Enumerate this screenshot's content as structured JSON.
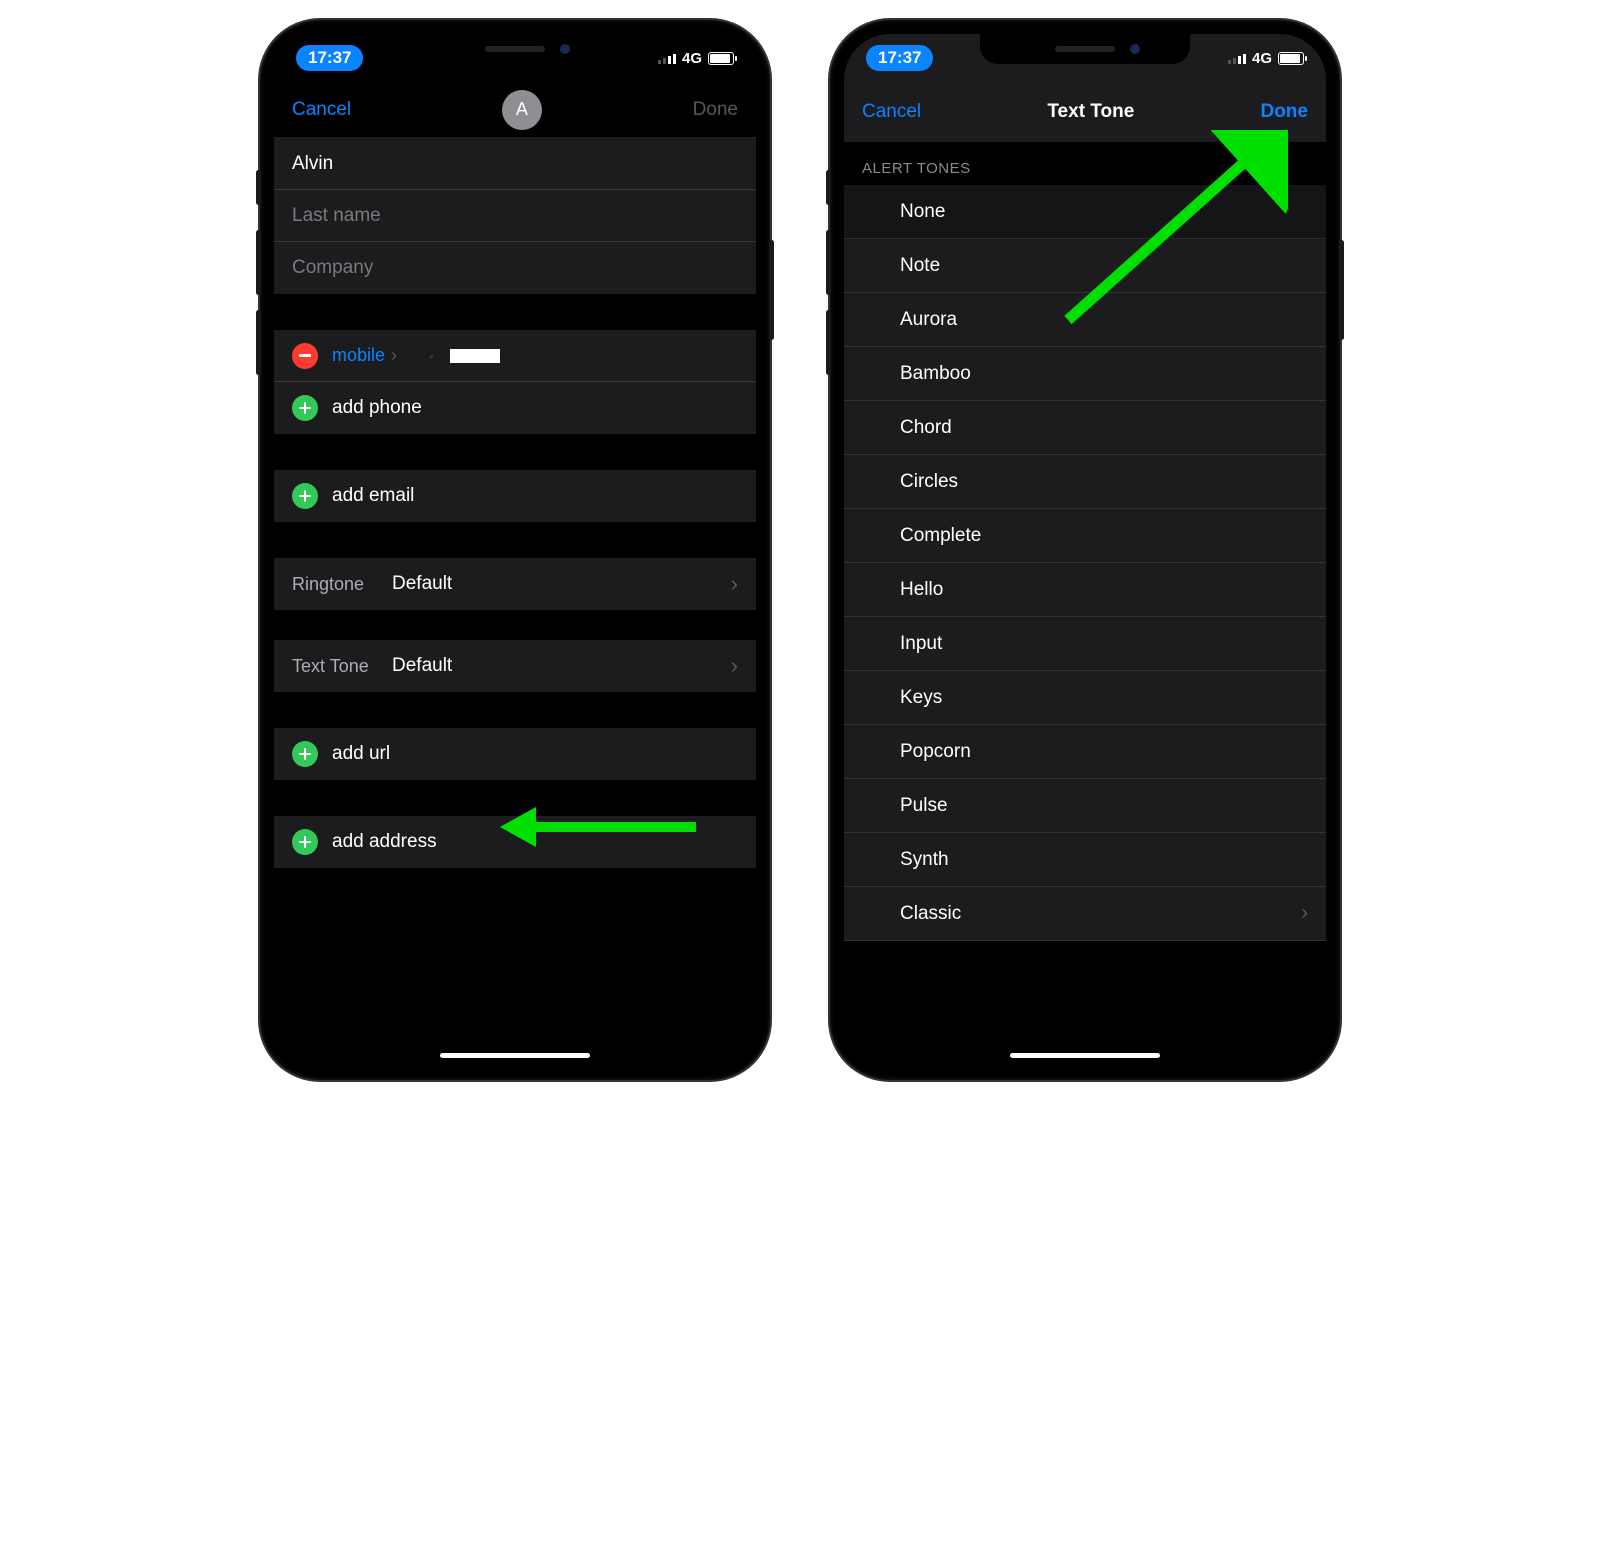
{
  "statusbar": {
    "time": "17:37",
    "network": "4G"
  },
  "left": {
    "nav": {
      "cancel": "Cancel",
      "done": "Done",
      "avatar_initial": "A"
    },
    "fields": {
      "first_name": "Alvin",
      "last_name_placeholder": "Last name",
      "company_placeholder": "Company"
    },
    "phone": {
      "type": "mobile",
      "add_phone": "add phone"
    },
    "email": {
      "add_email": "add email"
    },
    "ringtone": {
      "label": "Ringtone",
      "value": "Default"
    },
    "texttone": {
      "label": "Text Tone",
      "value": "Default"
    },
    "url": {
      "add_url": "add url"
    },
    "address": {
      "add_address": "add address"
    }
  },
  "right": {
    "nav": {
      "cancel": "Cancel",
      "title": "Text Tone",
      "done": "Done"
    },
    "section_header": "ALERT TONES",
    "tones": [
      "None",
      "Note",
      "Aurora",
      "Bamboo",
      "Chord",
      "Circles",
      "Complete",
      "Hello",
      "Input",
      "Keys",
      "Popcorn",
      "Pulse",
      "Synth",
      "Classic"
    ]
  }
}
